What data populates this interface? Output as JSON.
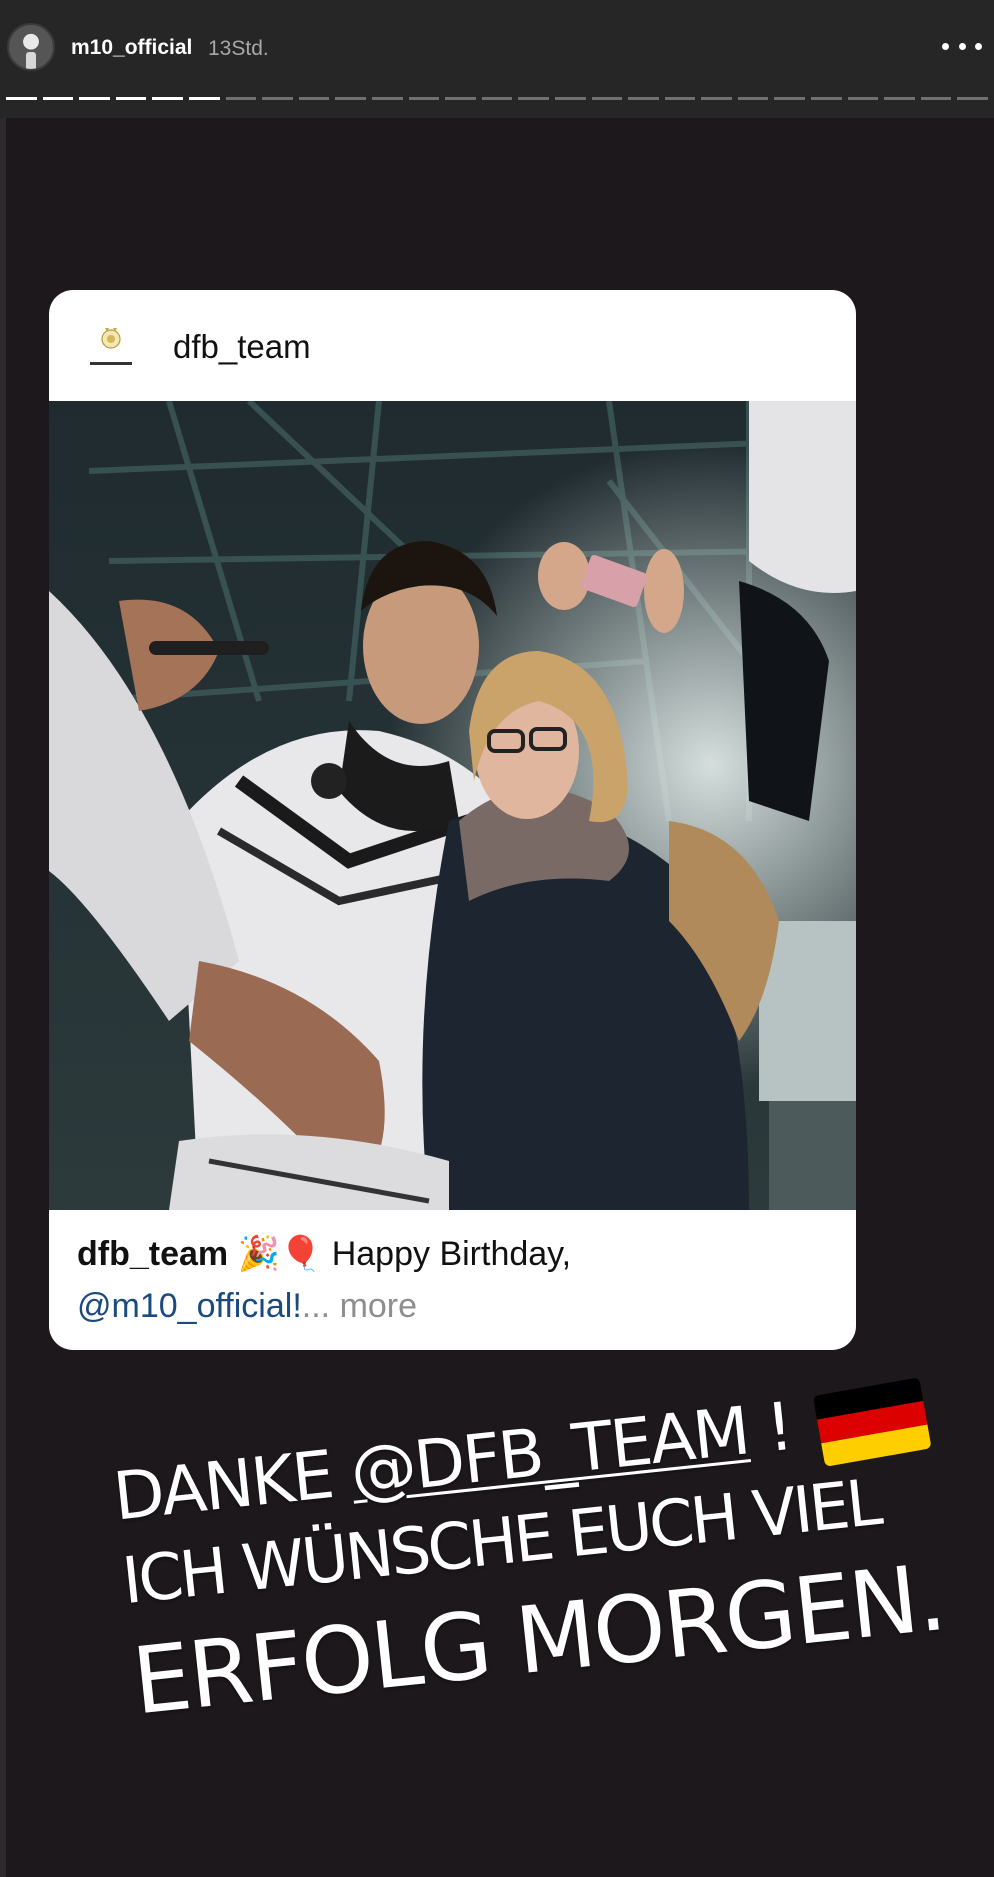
{
  "header": {
    "username": "m10_official",
    "timestamp": "13Std.",
    "more_icon": "more-horizontal-icon",
    "progress_segments_total": 27,
    "progress_segments_done": 6
  },
  "card": {
    "username": "dfb_team",
    "logo_icon": "dfb-crest-icon",
    "caption_user": "dfb_team",
    "caption_emoji": "🎉🎈",
    "caption_text": " Happy Birthday,",
    "caption_mention": "@m10_official!",
    "caption_more": "... more"
  },
  "overlay": {
    "line1_prefix": "Danke ",
    "line1_tag": "@DFB_TEAM",
    "line1_suffix": " !",
    "line2": "Ich wünsche euch viel",
    "line3": "Erfolg morgen."
  },
  "colors": {
    "background": "#1c181c",
    "topbar": "#262626",
    "mention": "#1b4a7f",
    "flag_black": "#000000",
    "flag_red": "#dd0000",
    "flag_gold": "#ffce00"
  }
}
